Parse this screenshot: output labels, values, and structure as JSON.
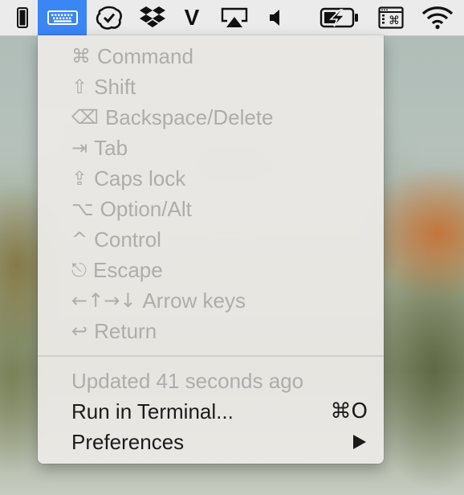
{
  "menubar": {
    "icons": [
      "phone-icon",
      "keyboard-icon",
      "checkmark-cloud-icon",
      "dropbox-icon",
      "vivaldi-icon",
      "airplay-icon",
      "volume-icon",
      "battery-charging-icon",
      "keyboard-command-viewer-icon",
      "wifi-icon"
    ],
    "vivaldi_letter": "V",
    "active_color": "#3b86f5"
  },
  "menu": {
    "items": [
      {
        "glyph": "⌘",
        "label": "Command"
      },
      {
        "glyph": "⇧",
        "label": "Shift"
      },
      {
        "glyph": "⌫",
        "label": "Backspace/Delete"
      },
      {
        "glyph": "⇥",
        "label": "Tab"
      },
      {
        "glyph": "⇪",
        "label": "Caps lock"
      },
      {
        "glyph": "⌥",
        "label": "Option/Alt"
      },
      {
        "glyph": "^",
        "label": "Control"
      },
      {
        "glyph": "⎋",
        "label": "Escape"
      },
      {
        "glyph": "←↑→↓",
        "label": "Arrow keys"
      },
      {
        "glyph": "↩",
        "label": "Return"
      }
    ],
    "updated_text": "Updated 41 seconds ago",
    "run_terminal_label": "Run in Terminal...",
    "run_terminal_shortcut": "⌘O",
    "preferences_label": "Preferences"
  }
}
